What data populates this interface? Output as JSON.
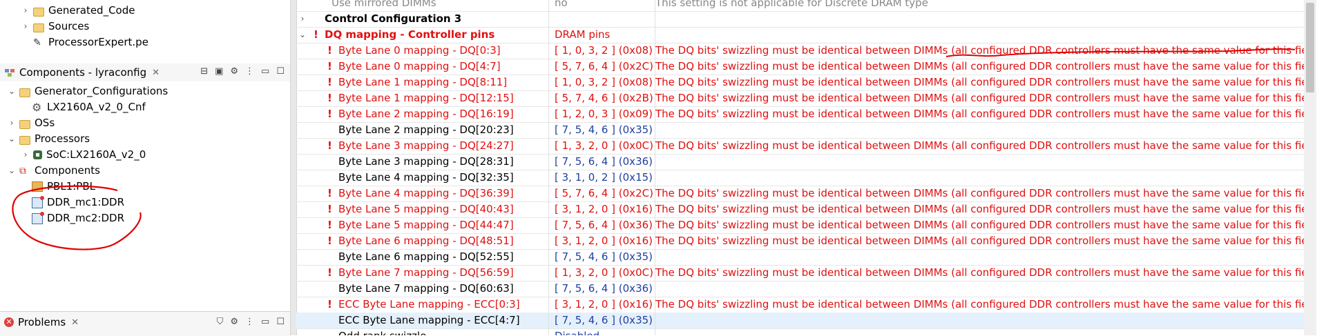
{
  "project_tree": {
    "items": [
      {
        "label": "Generated_Code",
        "icon": "folder-icon"
      },
      {
        "label": "Sources",
        "icon": "folder-icon"
      },
      {
        "label": "ProcessorExpert.pe",
        "icon": "pe-file-icon"
      }
    ]
  },
  "components_view": {
    "title": "Components - lyraconfig",
    "tree": [
      {
        "label": "Generator_Configurations"
      },
      {
        "label": "LX2160A_v2_0_Cnf"
      },
      {
        "label": "OSs"
      },
      {
        "label": "Processors"
      },
      {
        "label": "SoC:LX2160A_v2_0"
      },
      {
        "label": "Components"
      },
      {
        "label": "PBL1:PBL"
      },
      {
        "label": "DDR_mc1:DDR"
      },
      {
        "label": "DDR_mc2:DDR"
      }
    ]
  },
  "problems_view": {
    "title": "Problems"
  },
  "table": {
    "rows": [
      {
        "name": "Use mirrored DIMMs",
        "value": "no",
        "detail": "This setting is not applicable for Discrete DRAM type"
      },
      {
        "name": "Control Configuration 3",
        "value": "",
        "detail": ""
      },
      {
        "name": "DQ mapping - Controller pins",
        "value": "DRAM pins",
        "detail": ""
      },
      {
        "name": "Byte Lane 0 mapping - DQ[0:3]",
        "value": "[ 1, 0, 3, 2 ] (0x08)",
        "detail": "The DQ bits' swizzling must be identical between DIMMs (all configured DDR controllers must have the same value for this field)"
      },
      {
        "name": "Byte Lane 0 mapping - DQ[4:7]",
        "value": "[ 5, 7, 6, 4 ] (0x2C)",
        "detail": "The DQ bits' swizzling must be identical between DIMMs (all configured DDR controllers must have the same value for this field)"
      },
      {
        "name": "Byte Lane 1 mapping - DQ[8:11]",
        "value": "[ 1, 0, 3, 2 ] (0x08)",
        "detail": "The DQ bits' swizzling must be identical between DIMMs (all configured DDR controllers must have the same value for this field)"
      },
      {
        "name": "Byte Lane 1 mapping - DQ[12:15]",
        "value": "[ 5, 7, 4, 6 ] (0x2B)",
        "detail": "The DQ bits' swizzling must be identical between DIMMs (all configured DDR controllers must have the same value for this field)"
      },
      {
        "name": "Byte Lane 2 mapping - DQ[16:19]",
        "value": "[ 1, 2, 0, 3 ] (0x09)",
        "detail": "The DQ bits' swizzling must be identical between DIMMs (all configured DDR controllers must have the same value for this field)"
      },
      {
        "name": "Byte Lane 2 mapping - DQ[20:23]",
        "value": "[ 7, 5, 4, 6 ] (0x35)",
        "detail": ""
      },
      {
        "name": "Byte Lane 3 mapping - DQ[24:27]",
        "value": "[ 1, 3, 2, 0 ] (0x0C)",
        "detail": "The DQ bits' swizzling must be identical between DIMMs (all configured DDR controllers must have the same value for this field)"
      },
      {
        "name": "Byte Lane 3 mapping - DQ[28:31]",
        "value": "[ 7, 5, 6, 4 ] (0x36)",
        "detail": ""
      },
      {
        "name": "Byte Lane 4 mapping - DQ[32:35]",
        "value": "[ 3, 1, 0, 2 ] (0x15)",
        "detail": ""
      },
      {
        "name": "Byte Lane 4 mapping - DQ[36:39]",
        "value": "[ 5, 7, 6, 4 ] (0x2C)",
        "detail": "The DQ bits' swizzling must be identical between DIMMs (all configured DDR controllers must have the same value for this field)"
      },
      {
        "name": "Byte Lane 5 mapping - DQ[40:43]",
        "value": "[ 3, 1, 2, 0 ] (0x16)",
        "detail": "The DQ bits' swizzling must be identical between DIMMs (all configured DDR controllers must have the same value for this field)"
      },
      {
        "name": "Byte Lane 5 mapping - DQ[44:47]",
        "value": "[ 7, 5, 6, 4 ] (0x36)",
        "detail": "The DQ bits' swizzling must be identical between DIMMs (all configured DDR controllers must have the same value for this field)"
      },
      {
        "name": "Byte Lane 6 mapping - DQ[48:51]",
        "value": "[ 3, 1, 2, 0 ] (0x16)",
        "detail": "The DQ bits' swizzling must be identical between DIMMs (all configured DDR controllers must have the same value for this field)"
      },
      {
        "name": "Byte Lane 6 mapping - DQ[52:55]",
        "value": "[ 7, 5, 4, 6 ] (0x35)",
        "detail": ""
      },
      {
        "name": "Byte Lane 7 mapping - DQ[56:59]",
        "value": "[ 1, 3, 2, 0 ] (0x0C)",
        "detail": "The DQ bits' swizzling must be identical between DIMMs (all configured DDR controllers must have the same value for this field)"
      },
      {
        "name": "Byte Lane 7 mapping - DQ[60:63]",
        "value": "[ 7, 5, 6, 4 ] (0x36)",
        "detail": ""
      },
      {
        "name": "ECC Byte Lane mapping - ECC[0:3]",
        "value": "[ 3, 1, 2, 0 ] (0x16)",
        "detail": "The DQ bits' swizzling must be identical between DIMMs (all configured DDR controllers must have the same value for this field)"
      },
      {
        "name": "ECC Byte Lane mapping - ECC[4:7]",
        "value": "[ 7, 5, 4, 6 ] (0x35)",
        "detail": ""
      },
      {
        "name": "Odd rank swizzle",
        "value": "Disabled",
        "detail": ""
      }
    ]
  },
  "colors": {
    "error": "#e01010",
    "value_blue": "#1f3f9f",
    "selection": "#e4f0fb"
  }
}
